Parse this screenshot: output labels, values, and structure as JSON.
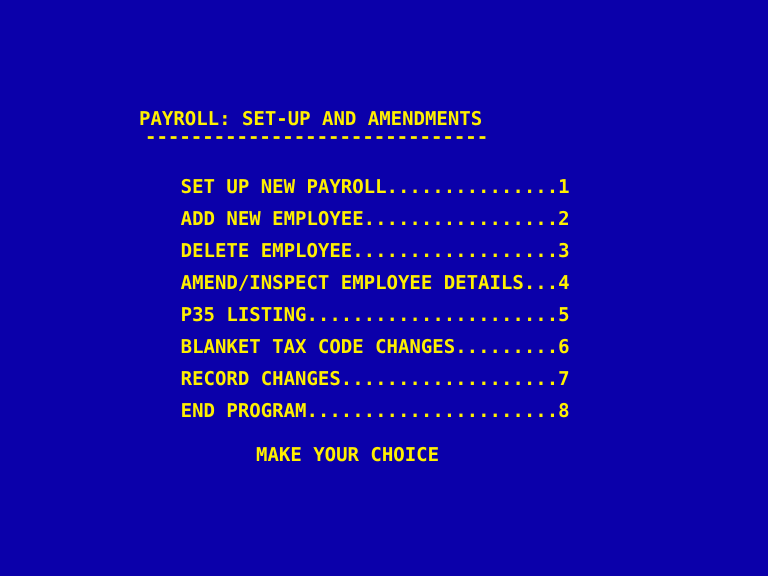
{
  "screen": {
    "background_color": "#0B00AA",
    "foreground_color": "#FFF000",
    "columns": 34
  },
  "header": {
    "title": "PAYROLL: SET-UP AND AMENDMENTS",
    "rule": "------------------------------"
  },
  "menu": {
    "items": [
      {
        "label": "SET UP NEW PAYROLL",
        "leader": "...............",
        "key": "1"
      },
      {
        "label": "ADD NEW EMPLOYEE",
        "leader": ".................",
        "key": "2"
      },
      {
        "label": "DELETE EMPLOYEE",
        "leader": "..................",
        "key": "3"
      },
      {
        "label": "AMEND/INSPECT EMPLOYEE DETAILS",
        "leader": "...",
        "key": "4"
      },
      {
        "label": "P35 LISTING",
        "leader": "......................",
        "key": "5"
      },
      {
        "label": "BLANKET TAX CODE CHANGES",
        "leader": ".........",
        "key": "6"
      },
      {
        "label": "RECORD CHANGES",
        "leader": "...................",
        "key": "7"
      },
      {
        "label": "END PROGRAM",
        "leader": "......................",
        "key": "8"
      }
    ]
  },
  "footer": {
    "prompt": "MAKE YOUR CHOICE"
  }
}
